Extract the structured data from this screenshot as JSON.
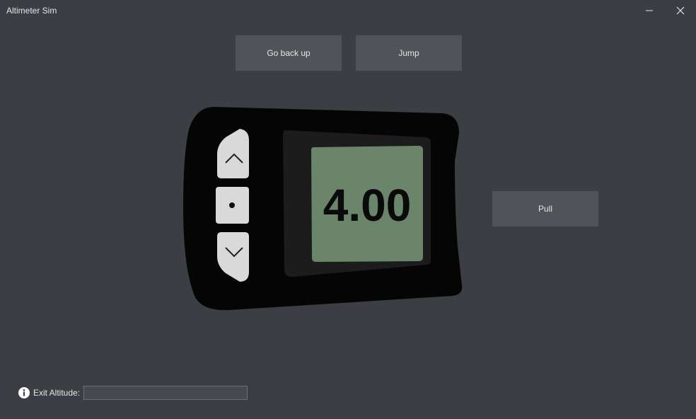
{
  "window": {
    "title": "Altimeter Sim"
  },
  "buttons": {
    "go_back_up": "Go back up",
    "jump": "Jump",
    "pull": "Pull"
  },
  "altimeter": {
    "display_value": "4.00"
  },
  "exit_altitude": {
    "label": "Exit Altitude:",
    "value": ""
  },
  "icons": {
    "info": "info-icon",
    "up": "chevron-up-icon",
    "center": "dot-icon",
    "down": "chevron-down-icon",
    "minimize": "minimize-icon",
    "close": "close-icon"
  },
  "colors": {
    "background": "#3b3e42",
    "button": "#505357",
    "device_body": "#050505",
    "lcd": "#6b856a"
  }
}
